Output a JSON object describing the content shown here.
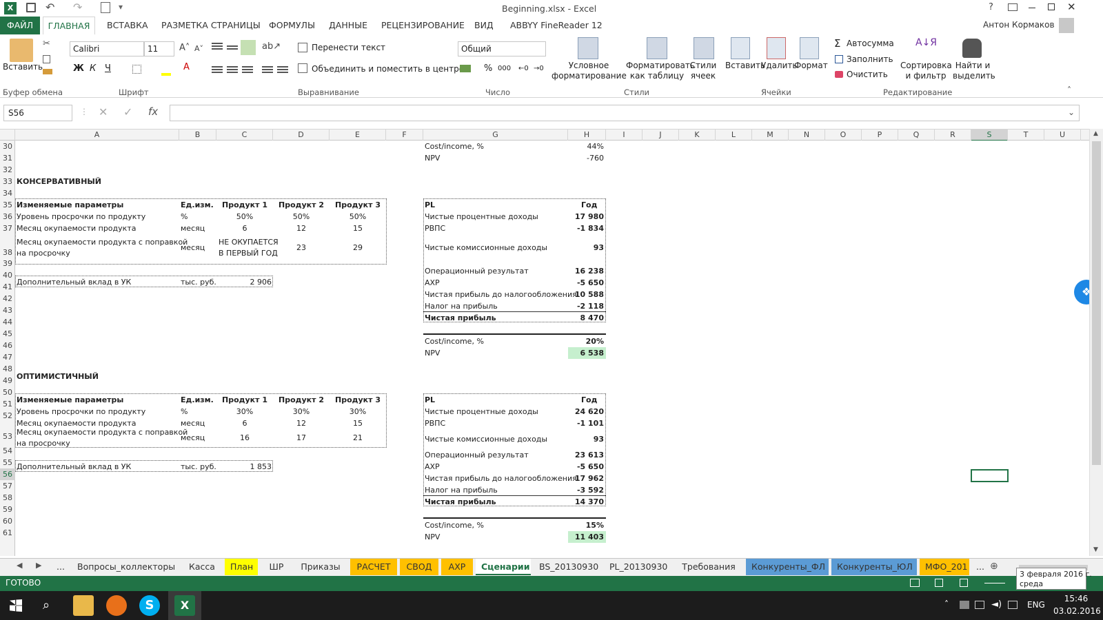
{
  "window": {
    "title": "Beginning.xlsx - Excel",
    "user": "Антон Кормаков",
    "help": "?"
  },
  "ribbon_tabs": [
    "ФАЙЛ",
    "ГЛАВНАЯ",
    "ВСТАВКА",
    "РАЗМЕТКА СТРАНИЦЫ",
    "ФОРМУЛЫ",
    "ДАННЫЕ",
    "РЕЦЕНЗИРОВАНИЕ",
    "ВИД",
    "ABBYY FineReader 12"
  ],
  "ribbon": {
    "paste": "Вставить",
    "font_name": "Calibri",
    "font_size": "11",
    "bold": "Ж",
    "italic": "К",
    "underline": "Ч",
    "wrap": "Перенести текст",
    "merge": "Объединить и поместить в центре",
    "number_format": "Общий",
    "cond_format": "Условное форматирование",
    "format_table": "Форматировать как таблицу",
    "cell_styles": "Стили ячеек",
    "insert": "Вставить",
    "delete": "Удалить",
    "format": "Формат",
    "autosum": "Автосумма",
    "fill": "Заполнить",
    "clear": "Очистить",
    "sort": "Сортировка и фильтр",
    "find": "Найти и выделить",
    "groups": {
      "clipboard": "Буфер обмена",
      "font": "Шрифт",
      "alignment": "Выравнивание",
      "number": "Число",
      "styles": "Стили",
      "cells": "Ячейки",
      "editing": "Редактирование"
    }
  },
  "formula_bar": {
    "name_box": "S56",
    "formula": ""
  },
  "columns": [
    "A",
    "B",
    "C",
    "D",
    "E",
    "F",
    "G",
    "H",
    "I",
    "J",
    "K",
    "L",
    "M",
    "N",
    "O",
    "P",
    "Q",
    "R",
    "S",
    "T",
    "U"
  ],
  "rows": [
    "30",
    "31",
    "32",
    "33",
    "34",
    "35",
    "36",
    "37",
    "38",
    "39",
    "40",
    "41",
    "42",
    "43",
    "44",
    "45",
    "46",
    "47",
    "48",
    "49",
    "50",
    "51",
    "52",
    "53",
    "54",
    "55",
    "56",
    "57",
    "58",
    "59",
    "60",
    "61"
  ],
  "top": {
    "cost_label": "Cost/income, %",
    "cost_val": "44%",
    "npv_label": "NPV",
    "npv_val": "-760"
  },
  "conservative": {
    "title": "КОНСЕРВАТИВНЫЙ",
    "hdr": [
      "Изменяемые параметры",
      "Ед.изм.",
      "Продукт 1",
      "Продукт 2",
      "Продукт 3"
    ],
    "r1": [
      "Уровень просрочки по продукту",
      "%",
      "50%",
      "50%",
      "50%"
    ],
    "r2": [
      "Месяц окупаемости продукта",
      "месяц",
      "6",
      "12",
      "15"
    ],
    "r3a": "Месяц окупаемости продукта с поправкой",
    "r3b": "на просрочку",
    "r3unit": "месяц",
    "r3c1a": "НЕ ОКУПАЕТСЯ",
    "r3c1b": "В ПЕРВЫЙ ГОД",
    "r3c2": "23",
    "r3c3": "29",
    "dep": [
      "Дополнительный вклад в УК",
      "тыс. руб.",
      "2 906"
    ],
    "pl_hdr": [
      "PL",
      "Год"
    ],
    "pl": [
      [
        "Чистые процентные доходы",
        "17 980"
      ],
      [
        "РВПС",
        "-1 834"
      ],
      [
        "Чистые комиссионные доходы",
        "93"
      ],
      [
        "Операционный результат",
        "16 238"
      ],
      [
        "АХР",
        "-5 650"
      ],
      [
        "Чистая прибыль до налогообложения",
        "10 588"
      ],
      [
        "Налог на прибыль",
        "-2 118"
      ],
      [
        "Чистая прибыль",
        "8 470"
      ]
    ],
    "cost": [
      "Cost/income, %",
      "20%"
    ],
    "npv": [
      "NPV",
      "6 538"
    ]
  },
  "optimistic": {
    "title": "ОПТИМИСТИЧНЫЙ",
    "hdr": [
      "Изменяемые параметры",
      "Ед.изм.",
      "Продукт 1",
      "Продукт 2",
      "Продукт 3"
    ],
    "r1": [
      "Уровень просрочки по продукту",
      "%",
      "30%",
      "30%",
      "30%"
    ],
    "r2": [
      "Месяц окупаемости продукта",
      "месяц",
      "6",
      "12",
      "15"
    ],
    "r3a": "Месяц окупаемости продукта с поправкой",
    "r3b": "на просрочку",
    "r3unit": "месяц",
    "r3c1": "16",
    "r3c2": "17",
    "r3c3": "21",
    "dep": [
      "Дополнительный вклад в УК",
      "тыс. руб.",
      "1 853"
    ],
    "pl_hdr": [
      "PL",
      "Год"
    ],
    "pl": [
      [
        "Чистые процентные доходы",
        "24 620"
      ],
      [
        "РВПС",
        "-1 101"
      ],
      [
        "Чистые комиссионные доходы",
        "93"
      ],
      [
        "Операционный результат",
        "23 613"
      ],
      [
        "АХР",
        "-5 650"
      ],
      [
        "Чистая прибыль до налогообложения",
        "17 962"
      ],
      [
        "Налог на прибыль",
        "-3 592"
      ],
      [
        "Чистая прибыль",
        "14 370"
      ]
    ],
    "cost": [
      "Cost/income, %",
      "15%"
    ],
    "npv": [
      "NPV",
      "11 403"
    ]
  },
  "sheet_tabs": [
    "...",
    "Вопросы_коллекторы",
    "Касса",
    "План",
    "ШР",
    "Приказы",
    "РАСЧЕТ",
    "СВОД",
    "АХР",
    "Сценарии",
    "BS_20130930",
    "PL_20130930",
    "Требования",
    "Конкуренты_ФЛ",
    "Конкуренты_ЮЛ",
    "МФО_201",
    "..."
  ],
  "status": {
    "ready": "ГОТОВО",
    "tooltip_date": "3 февраля 2016 г.",
    "tooltip_day": "среда"
  },
  "taskbar": {
    "lang": "ENG",
    "time": "15:46",
    "date": "03.02.2016"
  },
  "colors": {
    "excel_green": "#217346",
    "npv_green": "#c6efce",
    "tab_yellow": "#ffff00",
    "tab_orange": "#ffc000",
    "tab_blue": "#5b9bd5"
  }
}
